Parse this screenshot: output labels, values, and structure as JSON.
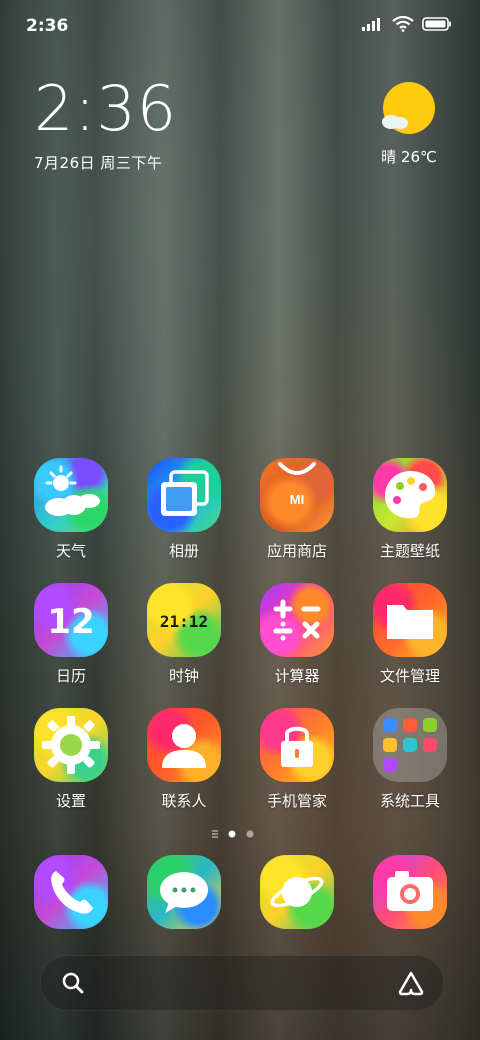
{
  "status": {
    "time": "2:36"
  },
  "clock": {
    "time": "2:36",
    "date": "7月26日 周三下午"
  },
  "weather": {
    "text": "晴 26℃"
  },
  "apps": [
    {
      "label": "天气"
    },
    {
      "label": "相册"
    },
    {
      "label": "应用商店"
    },
    {
      "label": "主题壁纸"
    },
    {
      "label": "日历"
    },
    {
      "label": "时钟"
    },
    {
      "label": "计算器"
    },
    {
      "label": "文件管理"
    },
    {
      "label": "设置"
    },
    {
      "label": "联系人"
    },
    {
      "label": "手机管家"
    },
    {
      "label": "系统工具"
    }
  ],
  "icon_text": {
    "calendar_day": "12",
    "clock_face": "21:12",
    "store_logo": "MI"
  },
  "dock": [
    "phone-icon",
    "messages-icon",
    "browser-icon",
    "camera-icon"
  ],
  "pages": {
    "count": 2,
    "current": 1
  }
}
